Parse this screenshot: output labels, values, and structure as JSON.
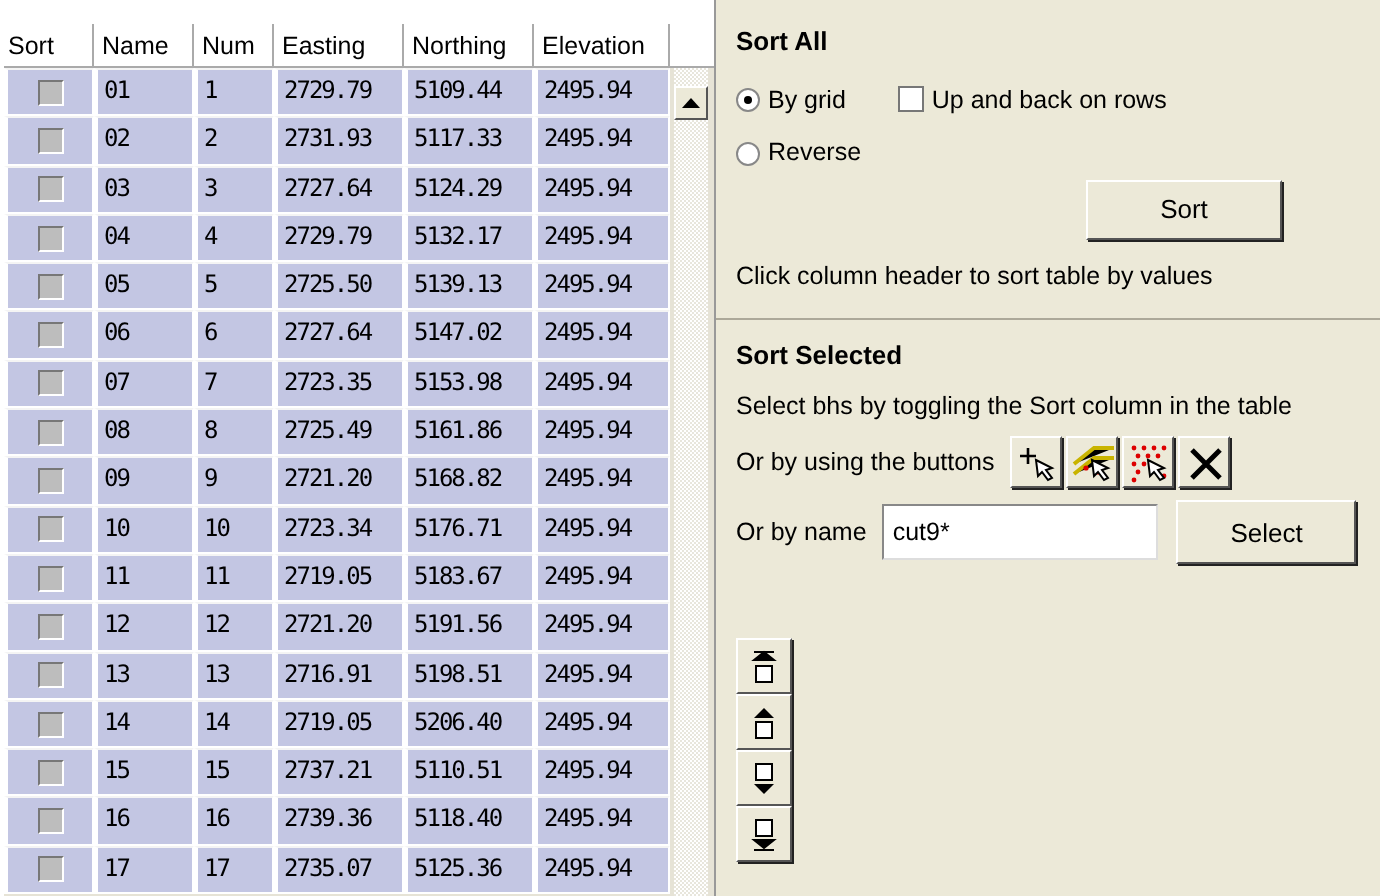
{
  "table": {
    "columns": [
      "Sort",
      "Name",
      "Num",
      "Easting",
      "Northing",
      "Elevation"
    ],
    "rows": [
      {
        "checked": false,
        "name": "01",
        "num": "1",
        "easting": "2729.79",
        "northing": "5109.44",
        "elevation": "2495.94"
      },
      {
        "checked": false,
        "name": "02",
        "num": "2",
        "easting": "2731.93",
        "northing": "5117.33",
        "elevation": "2495.94"
      },
      {
        "checked": false,
        "name": "03",
        "num": "3",
        "easting": "2727.64",
        "northing": "5124.29",
        "elevation": "2495.94"
      },
      {
        "checked": false,
        "name": "04",
        "num": "4",
        "easting": "2729.79",
        "northing": "5132.17",
        "elevation": "2495.94"
      },
      {
        "checked": false,
        "name": "05",
        "num": "5",
        "easting": "2725.50",
        "northing": "5139.13",
        "elevation": "2495.94"
      },
      {
        "checked": false,
        "name": "06",
        "num": "6",
        "easting": "2727.64",
        "northing": "5147.02",
        "elevation": "2495.94"
      },
      {
        "checked": false,
        "name": "07",
        "num": "7",
        "easting": "2723.35",
        "northing": "5153.98",
        "elevation": "2495.94"
      },
      {
        "checked": false,
        "name": "08",
        "num": "8",
        "easting": "2725.49",
        "northing": "5161.86",
        "elevation": "2495.94"
      },
      {
        "checked": false,
        "name": "09",
        "num": "9",
        "easting": "2721.20",
        "northing": "5168.82",
        "elevation": "2495.94"
      },
      {
        "checked": false,
        "name": "10",
        "num": "10",
        "easting": "2723.34",
        "northing": "5176.71",
        "elevation": "2495.94"
      },
      {
        "checked": false,
        "name": "11",
        "num": "11",
        "easting": "2719.05",
        "northing": "5183.67",
        "elevation": "2495.94"
      },
      {
        "checked": false,
        "name": "12",
        "num": "12",
        "easting": "2721.20",
        "northing": "5191.56",
        "elevation": "2495.94"
      },
      {
        "checked": false,
        "name": "13",
        "num": "13",
        "easting": "2716.91",
        "northing": "5198.51",
        "elevation": "2495.94"
      },
      {
        "checked": false,
        "name": "14",
        "num": "14",
        "easting": "2719.05",
        "northing": "5206.40",
        "elevation": "2495.94"
      },
      {
        "checked": false,
        "name": "15",
        "num": "15",
        "easting": "2737.21",
        "northing": "5110.51",
        "elevation": "2495.94"
      },
      {
        "checked": false,
        "name": "16",
        "num": "16",
        "easting": "2739.36",
        "northing": "5118.40",
        "elevation": "2495.94"
      },
      {
        "checked": false,
        "name": "17",
        "num": "17",
        "easting": "2735.07",
        "northing": "5125.36",
        "elevation": "2495.94"
      }
    ]
  },
  "sort_all": {
    "title": "Sort All",
    "radios": [
      {
        "label": "By grid",
        "selected": true
      },
      {
        "label": "Reverse",
        "selected": false
      }
    ],
    "checkbox": {
      "label": "Up and back on rows",
      "checked": false
    },
    "button": "Sort",
    "hint": "Click column header to sort table by values"
  },
  "sort_selected": {
    "title": "Sort Selected",
    "hint": "Select bhs by toggling the Sort column in the table",
    "buttons_label": "Or by using the buttons",
    "tool_buttons": [
      {
        "kind": "point"
      },
      {
        "kind": "line"
      },
      {
        "kind": "area"
      },
      {
        "kind": "clear"
      }
    ],
    "name_label": "Or by name",
    "name_value": "cut9*",
    "select_button": "Select"
  },
  "move_buttons": [
    {
      "kind": "top"
    },
    {
      "kind": "up"
    },
    {
      "kind": "down"
    },
    {
      "kind": "bottom"
    }
  ]
}
